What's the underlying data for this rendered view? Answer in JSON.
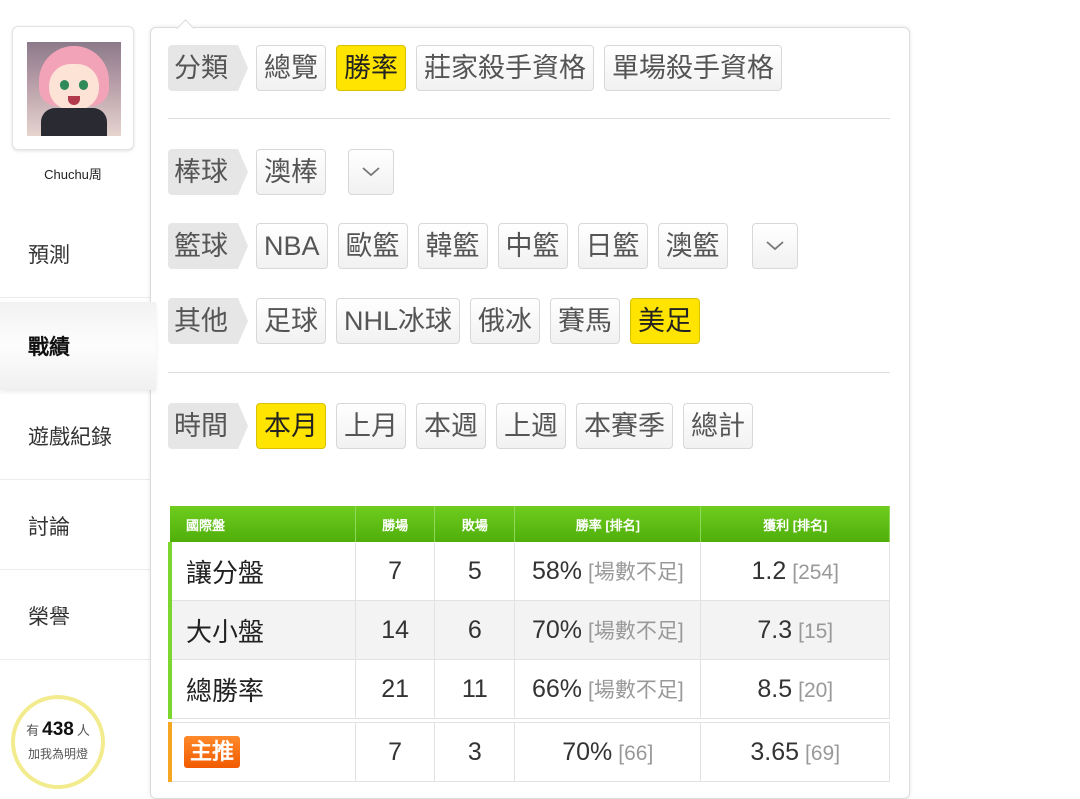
{
  "user": {
    "name": "Chuchu周"
  },
  "nav": [
    {
      "label": "預測"
    },
    {
      "label": "戰績"
    },
    {
      "label": "遊戲紀錄"
    },
    {
      "label": "討論"
    },
    {
      "label": "榮譽"
    }
  ],
  "fans": {
    "prefix": "有",
    "count": "438",
    "unit": "人",
    "text": "加我為明燈"
  },
  "filters": {
    "category": {
      "label": "分類",
      "options": [
        "總覽",
        "勝率",
        "莊家殺手資格",
        "單場殺手資格"
      ],
      "selected": "勝率"
    },
    "baseball": {
      "label": "棒球",
      "options": [
        "澳棒"
      ]
    },
    "basketball": {
      "label": "籃球",
      "options": [
        "NBA",
        "歐籃",
        "韓籃",
        "中籃",
        "日籃",
        "澳籃"
      ]
    },
    "other": {
      "label": "其他",
      "options": [
        "足球",
        "NHL冰球",
        "俄冰",
        "賽馬",
        "美足"
      ],
      "selected": "美足"
    },
    "time": {
      "label": "時間",
      "options": [
        "本月",
        "上月",
        "本週",
        "上週",
        "本賽季",
        "總計"
      ],
      "selected": "本月"
    }
  },
  "colors": {
    "accent_yellow": "#ffe400",
    "table_green": "#5dbd12",
    "badge_orange": "#f15a00"
  },
  "table": {
    "headers": [
      "國際盤",
      "勝場",
      "敗場",
      "勝率 [排名]",
      "獲利 [排名]"
    ],
    "rows": [
      {
        "name": "讓分盤",
        "wins": "7",
        "losses": "5",
        "rate": "58%",
        "rate_rank": "[場數不足]",
        "profit": "1.2",
        "profit_rank": "[254]"
      },
      {
        "name": "大小盤",
        "wins": "14",
        "losses": "6",
        "rate": "70%",
        "rate_rank": "[場數不足]",
        "profit": "7.3",
        "profit_rank": "[15]"
      },
      {
        "name": "總勝率",
        "wins": "21",
        "losses": "11",
        "rate": "66%",
        "rate_rank": "[場數不足]",
        "profit": "8.5",
        "profit_rank": "[20]"
      }
    ],
    "main_pick": {
      "badge": "主推",
      "wins": "7",
      "losses": "3",
      "rate": "70%",
      "rate_rank": "[66]",
      "profit": "3.65",
      "profit_rank": "[69]"
    }
  }
}
